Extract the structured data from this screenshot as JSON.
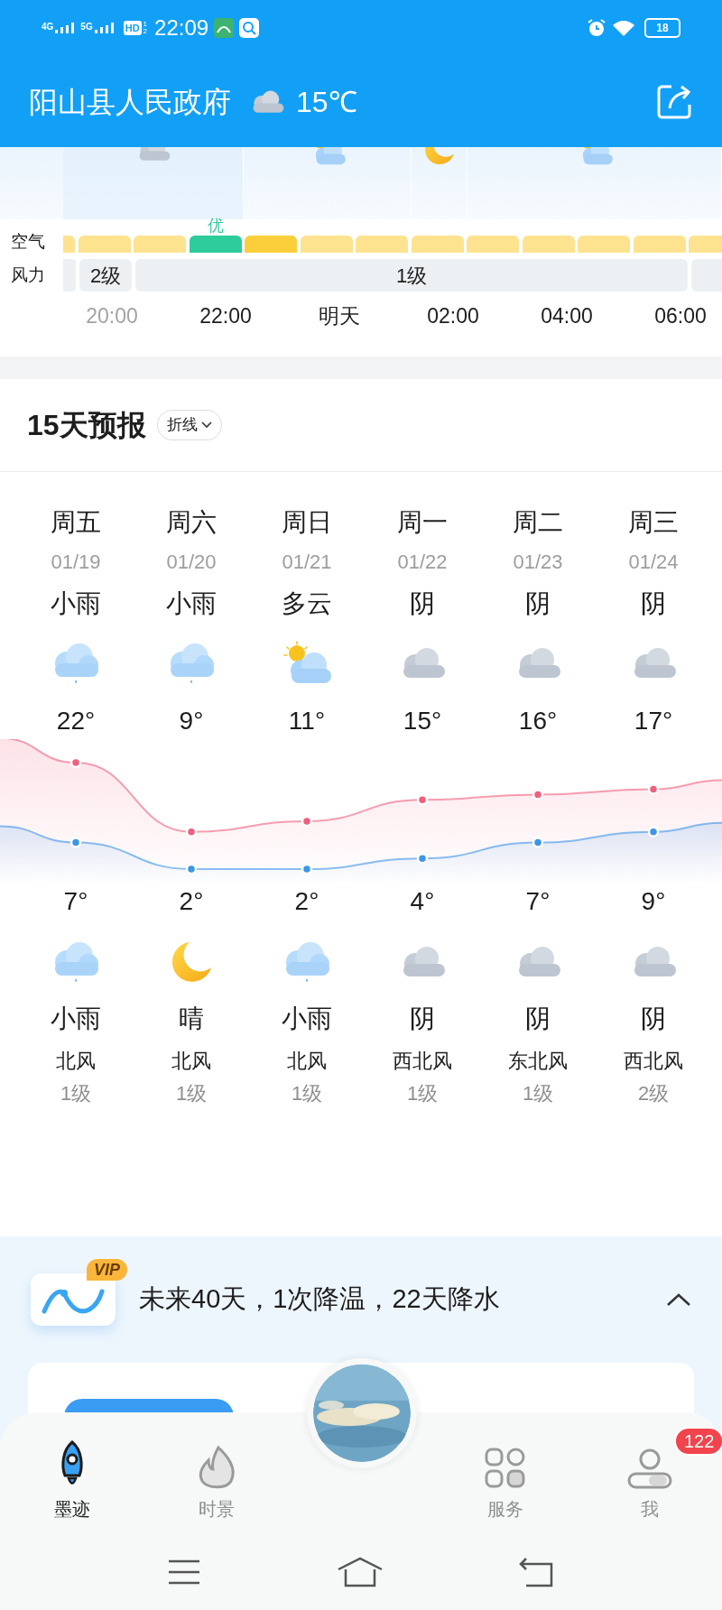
{
  "status_bar": {
    "network_1": "4G",
    "network_2": "5G",
    "hd": "HD",
    "hd_sub": [
      "1",
      "2"
    ],
    "time": "22:09",
    "battery": "18"
  },
  "header": {
    "location": "阳山县人民政府",
    "temperature": "15℃"
  },
  "hourly": {
    "periods": [
      {
        "kind": "overcast"
      },
      {
        "kind": "partly_cloudy"
      },
      {
        "kind": "moon"
      },
      {
        "kind": "partly_cloudy"
      }
    ],
    "air_label": "空气",
    "air": [
      {
        "color": "#fde38f"
      },
      {
        "color": "#fde38f"
      },
      {
        "color": "#fde38f"
      },
      {
        "color": "#2ecb9b",
        "label": "优"
      },
      {
        "color": "#fbcf3c"
      },
      {
        "color": "#fde38f"
      },
      {
        "color": "#fde38f"
      },
      {
        "color": "#fde38f"
      },
      {
        "color": "#fde38f"
      },
      {
        "color": "#fde38f"
      },
      {
        "color": "#fde38f"
      },
      {
        "color": "#fde38f"
      },
      {
        "color": "#fde38f"
      }
    ],
    "wind_label": "风力",
    "wind": [
      {
        "level": "2级"
      },
      {
        "level": "1级"
      }
    ],
    "times": [
      {
        "label": "20:00",
        "past": true
      },
      {
        "label": "22:00",
        "past": false
      },
      {
        "label": "明天",
        "past": false
      },
      {
        "label": "02:00",
        "past": false
      },
      {
        "label": "04:00",
        "past": false
      },
      {
        "label": "06:00",
        "past": false
      }
    ]
  },
  "forecast": {
    "title": "15天预报",
    "mode": "折线",
    "days": [
      {
        "weekday": "周五",
        "date": "01/19",
        "day": {
          "weather": "小雨",
          "kind": "rain"
        },
        "high": "22°",
        "low": "7°",
        "night": {
          "kind": "rain",
          "weather": "小雨"
        },
        "wind_dir": "北风",
        "wind_level": "1级"
      },
      {
        "weekday": "周六",
        "date": "01/20",
        "day": {
          "weather": "小雨",
          "kind": "rain"
        },
        "high": "9°",
        "low": "2°",
        "night": {
          "kind": "moon",
          "weather": "晴"
        },
        "wind_dir": "北风",
        "wind_level": "1级"
      },
      {
        "weekday": "周日",
        "date": "01/21",
        "day": {
          "weather": "多云",
          "kind": "partly_cloudy"
        },
        "high": "11°",
        "low": "2°",
        "night": {
          "kind": "rain",
          "weather": "小雨"
        },
        "wind_dir": "北风",
        "wind_level": "1级"
      },
      {
        "weekday": "周一",
        "date": "01/22",
        "day": {
          "weather": "阴",
          "kind": "overcast"
        },
        "high": "15°",
        "low": "4°",
        "night": {
          "kind": "overcast",
          "weather": "阴"
        },
        "wind_dir": "西北风",
        "wind_level": "1级"
      },
      {
        "weekday": "周二",
        "date": "01/23",
        "day": {
          "weather": "阴",
          "kind": "overcast"
        },
        "high": "16°",
        "low": "7°",
        "night": {
          "kind": "overcast",
          "weather": "阴"
        },
        "wind_dir": "东北风",
        "wind_level": "1级"
      },
      {
        "weekday": "周三",
        "date": "01/24",
        "day": {
          "weather": "阴",
          "kind": "overcast"
        },
        "high": "17°",
        "low": "9°",
        "night": {
          "kind": "overcast",
          "weather": "阴"
        },
        "wind_dir": "西北风",
        "wind_level": "2级"
      }
    ]
  },
  "outlook": {
    "badge": "VIP",
    "summary": "未来40天，1次降温，22天降水",
    "expanded": true
  },
  "tab_bar": {
    "items": [
      {
        "label": "墨迹",
        "kind": "rocket",
        "selected": true
      },
      {
        "label": "时景",
        "kind": "flame",
        "selected": false
      },
      {
        "label": "服务",
        "kind": "grid",
        "selected": false
      },
      {
        "label": "我",
        "kind": "person",
        "selected": false,
        "badge": "122"
      }
    ]
  }
}
